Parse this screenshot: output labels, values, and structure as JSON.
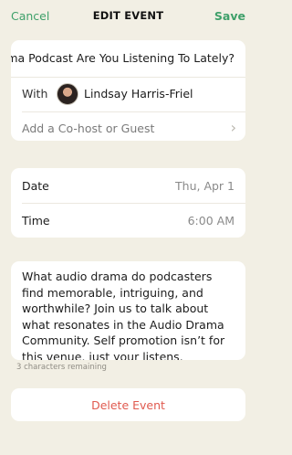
{
  "nav": {
    "cancel": "Cancel",
    "title": "EDIT EVENT",
    "save": "Save"
  },
  "event": {
    "title": "Audio Drama Podcast Are You Listening To Lately?",
    "with_label": "With",
    "host_name": "Lindsay Harris-Friel",
    "add_cohost": "Add a Co-host or Guest"
  },
  "schedule": {
    "date_label": "Date",
    "date_value": "Thu, Apr 1",
    "time_label": "Time",
    "time_value": "6:00 AM"
  },
  "description": {
    "text": "What audio drama do podcasters find memorable, intriguing, and worthwhile? Join us to talk about what resonates in the Audio Drama Community. Self promotion isn’t for this venue, just your listens.",
    "chars_remaining": "3 characters remaining"
  },
  "actions": {
    "delete": "Delete Event"
  },
  "colors": {
    "accent": "#3fa06a",
    "danger": "#e05a4f",
    "background": "#f2efe4"
  },
  "icons": {
    "avatar": "user-avatar",
    "chevron": "chevron-right-icon"
  }
}
